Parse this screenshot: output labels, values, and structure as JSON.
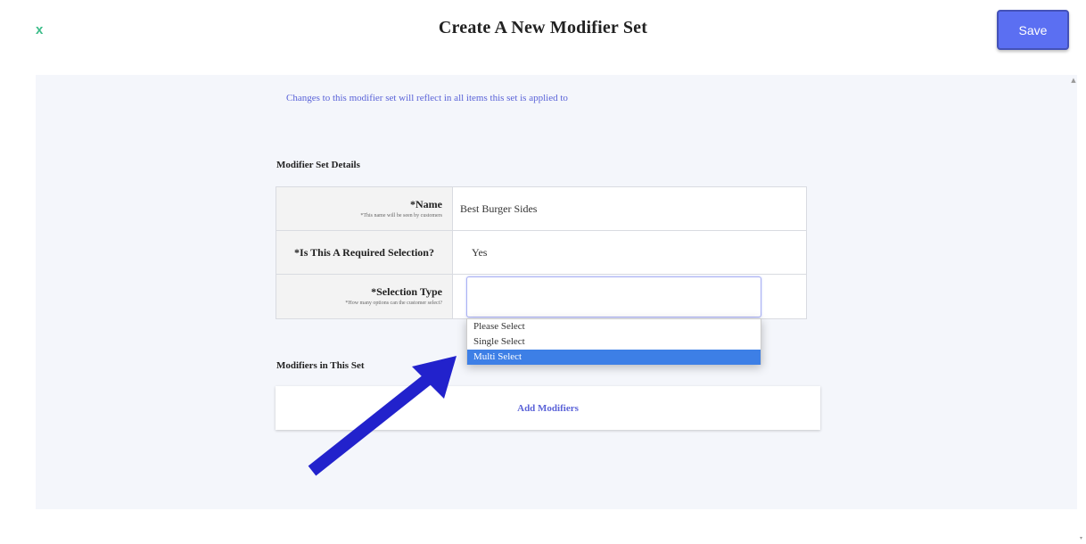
{
  "header": {
    "close_label": "x",
    "title": "Create A New Modifier Set",
    "save_label": "Save"
  },
  "notice": "Changes to this modifier set will reflect in all items this set is applied to",
  "details": {
    "section_title": "Modifier Set Details",
    "name_label": "*Name",
    "name_hint": "*This name will be seen by customers",
    "name_value": "Best Burger Sides",
    "required_label": "*Is This A Required Selection?",
    "required_value": "Yes",
    "selection_label": "*Selection Type",
    "selection_hint": "*How many options can the customer select?",
    "selection_value": ""
  },
  "dropdown": {
    "options": [
      "Please Select",
      "Single Select",
      "Multi Select"
    ],
    "highlighted": "Multi Select"
  },
  "modifiers": {
    "section_title": "Modifiers in This Set",
    "add_label": "Add Modifiers"
  },
  "colors": {
    "accent": "#5b6ff2",
    "close": "#3dbd8a",
    "arrow": "#2222cc",
    "highlight": "#3d7fe6"
  }
}
